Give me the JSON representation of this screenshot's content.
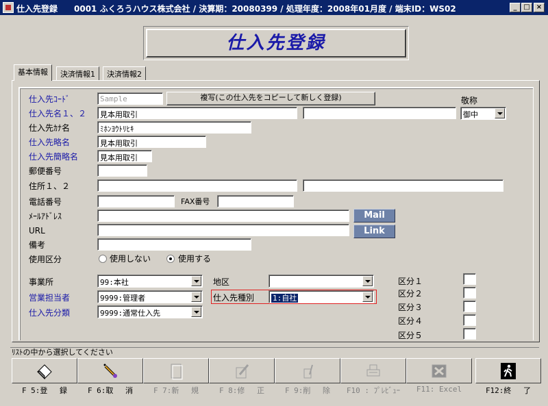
{
  "window": {
    "title": "仕入先登録　　0001 ふくろうハウス株式会社 / 決算期：20080399 / 処理年度：2008年01月度 / 端末ID：WS02",
    "minimize": "_",
    "maximize": "□",
    "close": "×"
  },
  "header": {
    "title": "仕入先登録"
  },
  "tabs": [
    "基本情報",
    "決済情報1",
    "決済情報2"
  ],
  "form": {
    "code_label": "仕入先ｺｰﾄﾞ",
    "code_placeholder": "Sample",
    "copy_button": "複写(この仕入先をコピーして新しく登録)",
    "honorific_label": "敬称",
    "honorific_value": "御中",
    "name_label": "仕入先名１、２",
    "name1": "見本用取引",
    "name2": "",
    "kana_label": "仕入先ｶﾅ名",
    "kana": "ﾐﾎﾝﾖｳﾄﾘﾋｷ",
    "short_label": "仕入先略名",
    "short": "見本用取引",
    "abbr_label": "仕入先簡略名",
    "abbr": "見本用取引",
    "zip_label": "郵便番号",
    "zip": "",
    "address_label": "住所１、２",
    "address1": "",
    "address2": "",
    "phone_label": "電話番号",
    "phone": "",
    "fax_label": "FAX番号",
    "fax": "",
    "email_label": "ﾒｰﾙｱﾄﾞﾚｽ",
    "email": "",
    "mail_button": "Mail",
    "url_label": "URL",
    "url": "",
    "link_button": "Link",
    "note_label": "備考",
    "note": "",
    "usage_label": "使用区分",
    "usage_options": [
      "使用しない",
      "使用する"
    ],
    "usage_selected": "使用する",
    "office_label": "事業所",
    "office_value": "99:本社",
    "sales_label": "営業担当者",
    "sales_value": "9999:管理者",
    "category_label": "仕入先分類",
    "category_value": "9999:通常仕入先",
    "region_label": "地区",
    "region_value": "",
    "type_label": "仕入先種別",
    "type_value": "1:自社",
    "kubun_labels": [
      "区分１",
      "区分２",
      "区分３",
      "区分４",
      "区分５"
    ]
  },
  "status": {
    "message": "ﾘｽﾄの中から選択してください"
  },
  "fkeys": [
    {
      "label": "F 5:登　 録",
      "icon": "eraser-icon",
      "enabled": true
    },
    {
      "label": "F 6:取　 消",
      "icon": "brush-icon",
      "enabled": true
    },
    {
      "label": "F 7:新　 規",
      "icon": "new-page-icon",
      "enabled": false
    },
    {
      "label": "F 8:修　 正",
      "icon": "edit-icon",
      "enabled": false
    },
    {
      "label": "F 9:削　 除",
      "icon": "trash-icon",
      "enabled": false
    },
    {
      "label": "F10 : ﾌﾟﾚﾋﾞｭｰ",
      "icon": "printer-icon",
      "enabled": false
    },
    {
      "label": "F11: Excel",
      "icon": "excel-icon",
      "enabled": false
    },
    {
      "label": "F12:終　 了",
      "icon": "exit-icon",
      "enabled": true
    }
  ]
}
